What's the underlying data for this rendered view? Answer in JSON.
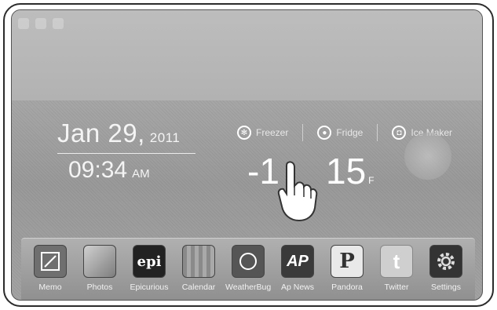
{
  "date": {
    "month_day": "Jan 29,",
    "year": "2011"
  },
  "time": {
    "clock": "09:34",
    "ampm": "AM"
  },
  "fridge_tabs": [
    {
      "label": "Freezer",
      "icon": "snowflake-icon"
    },
    {
      "label": "Fridge",
      "icon": "drop-icon"
    },
    {
      "label": "Ice Maker",
      "icon": "ice-cup-icon"
    }
  ],
  "temperatures": {
    "freezer": "-1",
    "fridge": "15",
    "unit": "F"
  },
  "dock": {
    "apps": [
      {
        "label": "Memo",
        "glyph": "",
        "icon": "memo-icon"
      },
      {
        "label": "Photos",
        "glyph": "",
        "icon": "photos-icon"
      },
      {
        "label": "Epicurious",
        "glyph": "epi",
        "icon": "epicurious-icon"
      },
      {
        "label": "Calendar",
        "glyph": "",
        "icon": "calendar-icon"
      },
      {
        "label": "WeatherBug",
        "glyph": "",
        "icon": "weatherbug-icon"
      },
      {
        "label": "Ap News",
        "glyph": "AP",
        "icon": "ap-news-icon"
      },
      {
        "label": "Pandora",
        "glyph": "P",
        "icon": "pandora-icon"
      },
      {
        "label": "Twitter",
        "glyph": "t",
        "icon": "twitter-icon"
      },
      {
        "label": "Settings",
        "glyph": "",
        "icon": "settings-icon"
      }
    ]
  }
}
